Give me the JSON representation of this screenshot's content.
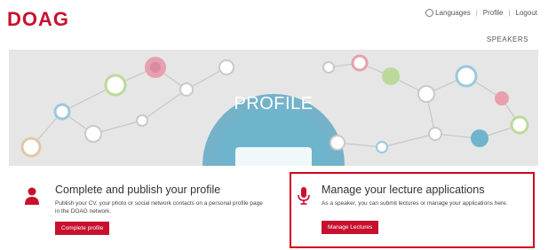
{
  "header": {
    "logo": "DOAG",
    "links": {
      "languages": "Languages",
      "profile": "Profile",
      "logout": "Logout"
    },
    "nav_speakers": "SPEAKERS"
  },
  "banner": {
    "title": "PROFILE"
  },
  "cards": [
    {
      "icon": "user-icon",
      "title": "Complete and publish your profile",
      "desc": "Publish your CV, your photo or social network contacts on a personal profile page in the DOAG network.",
      "button": "Complete profile"
    },
    {
      "icon": "microphone-icon",
      "title": "Manage your lecture applications",
      "desc": "As a speaker, you can submit lectures or manage your applications here.",
      "button": "Manage Lectures"
    }
  ],
  "colors": {
    "brand": "#c8102e",
    "highlight_border": "#d0021b",
    "banner_bg": "#e6e6e6"
  }
}
